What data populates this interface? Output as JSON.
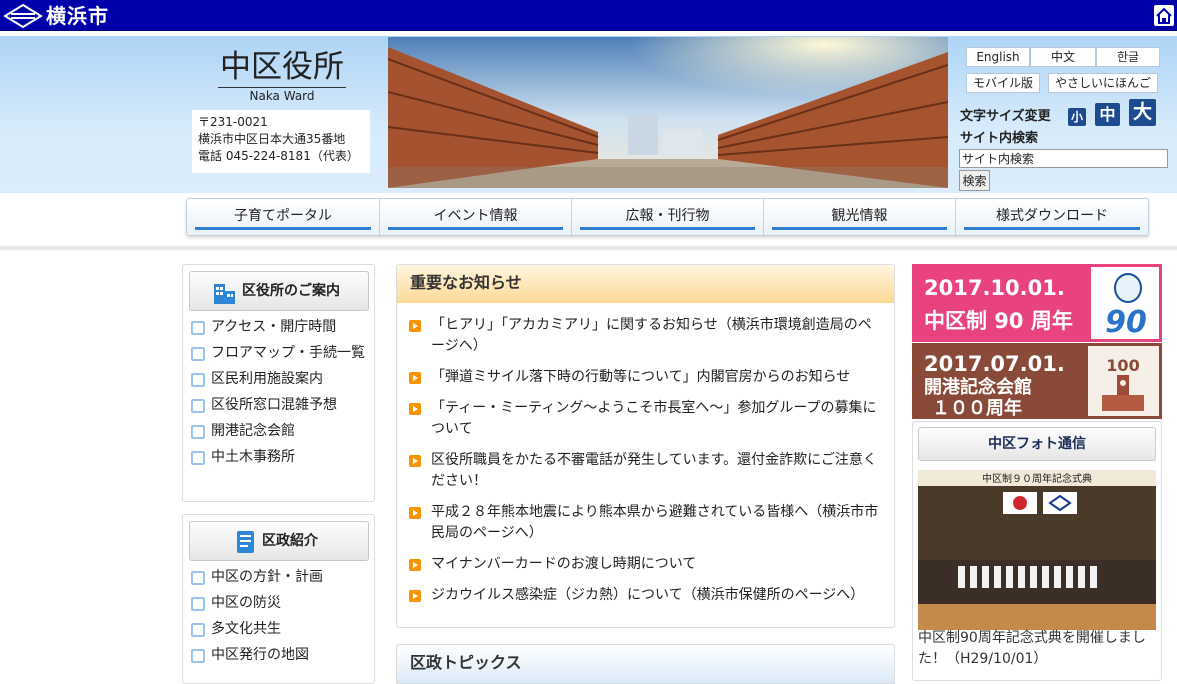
{
  "topbar": {
    "city_name": "横浜市"
  },
  "header": {
    "ward_name": "中区役所",
    "ward_name_roman": "Naka Ward",
    "address": {
      "postal": "〒231-0021",
      "street": "横浜市中区日本大通35番地",
      "phone": "電話 045-224-8181（代表）"
    }
  },
  "utility": {
    "languages": [
      "English",
      "中文",
      "한글"
    ],
    "mobile": "モバイル版",
    "easy_japanese": "やさしいにほんご",
    "font_size_label": "文字サイズ変更",
    "font_sizes": [
      "小",
      "中",
      "大"
    ],
    "search_label": "サイト内検索",
    "search_value": "サイト内検索",
    "search_button": "検索"
  },
  "global_nav": [
    "子育てポータル",
    "イベント情報",
    "広報・刊行物",
    "観光情報",
    "様式ダウンロード"
  ],
  "sidebar": {
    "guide": {
      "title": "区役所のご案内",
      "items": [
        "アクセス・開庁時間",
        "フロアマップ・手続一覧",
        "区民利用施設案内",
        "区役所窓口混雑予想",
        "開港記念会館",
        "中土木事務所"
      ]
    },
    "policy": {
      "title": "区政紹介",
      "items": [
        "中区の方針・計画",
        "中区の防災",
        "多文化共生",
        "中区発行の地図"
      ]
    }
  },
  "notices": {
    "title": "重要なお知らせ",
    "items": [
      "「ヒアリ」「アカカミアリ」に関するお知らせ（横浜市環境創造局のページへ）",
      "「弾道ミサイル落下時の行動等について」内閣官房からのお知らせ",
      "「ティー・ミーティング～ようこそ市長室へ～」参加グループの募集について",
      "区役所職員をかたる不審電話が発生しています。還付金詐欺にご注意ください！",
      "平成２８年熊本地震により熊本県から避難されている皆様へ（横浜市市民局のページへ）",
      "マイナンバーカードのお渡し時期について",
      "ジカウイルス感染症（ジカ熱）について（横浜市保健所のページへ）"
    ]
  },
  "topics": {
    "title": "区政トピックス"
  },
  "banners": {
    "anniv90": {
      "date": "2017.10.01.",
      "text": "中区制 90 周年",
      "badge": "90",
      "color": "#e8437f"
    },
    "hall100": {
      "date": "2017.07.01.",
      "text_line1": "開港記念会館",
      "text_line2": "１００周年",
      "badge": "100",
      "color": "#8a4a3a"
    }
  },
  "photo_news": {
    "title": "中区フォト通信",
    "stage_sign": "中区制９０周年記念式典",
    "caption": "中区制90周年記念式典を開催しました！（H29/10/01）"
  },
  "colors": {
    "topbar": "#0000aa",
    "header_bg": "#d7ebfb",
    "nav_accent": "#2c7ed6",
    "notice_icon": "#f79400",
    "fontsize_button": "#1d4b8f"
  }
}
